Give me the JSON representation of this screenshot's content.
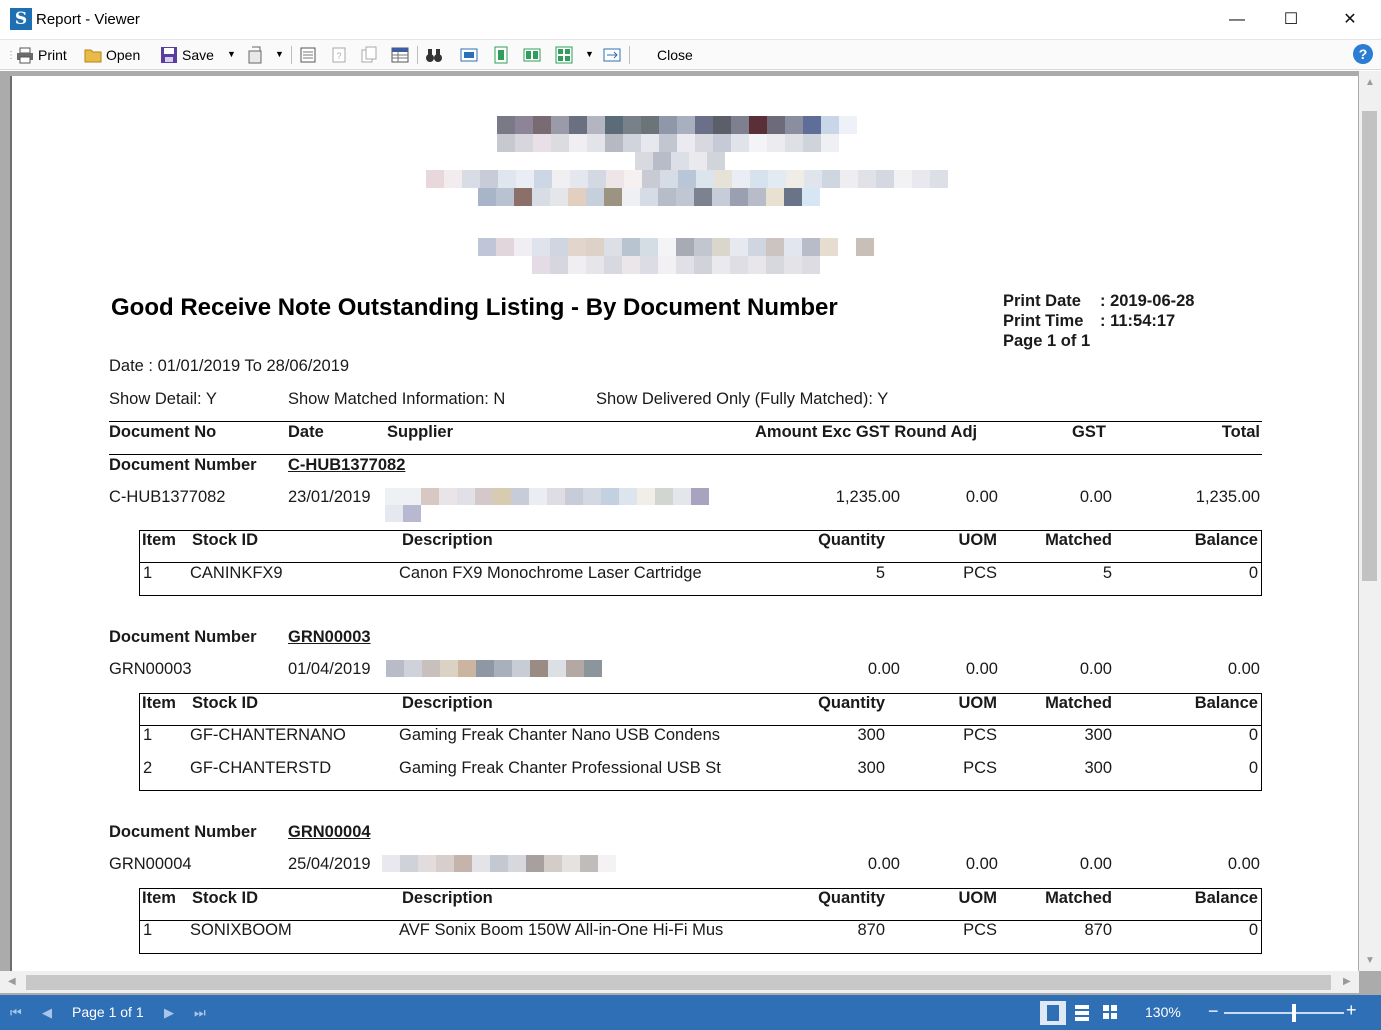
{
  "window": {
    "title": "Report - Viewer",
    "min": "—",
    "max": "☐",
    "close": "✕"
  },
  "toolbar": {
    "print": "Print",
    "open": "Open",
    "save": "Save",
    "close": "Close",
    "help": "?"
  },
  "report": {
    "title": "Good Receive Note Outstanding Listing - By Document Number",
    "print_date_label": "Print Date",
    "print_date_value": ": 2019-06-28",
    "print_time_label": "Print Time",
    "print_time_value": ": 11:54:17",
    "page_label": "Page 1 of 1",
    "date_range": "Date : 01/01/2019 To 28/06/2019",
    "show_detail": "Show Detail: Y",
    "show_matched": "Show Matched Information: N",
    "show_delivered": "Show Delivered Only (Fully Matched): Y",
    "headers": {
      "doc_no": "Document No",
      "date": "Date",
      "supplier": "Supplier",
      "amount": "Amount Exc GST Round Adj",
      "gst": "GST",
      "total": "Total"
    },
    "detail_headers": {
      "item": "Item",
      "stock_id": "Stock ID",
      "description": "Description",
      "quantity": "Quantity",
      "uom": "UOM",
      "matched": "Matched",
      "balance": "Balance"
    },
    "doc_number_label": "Document Number",
    "groups": [
      {
        "doc_number": "C-HUB1377082",
        "row": {
          "doc_no": "C-HUB1377082",
          "date": "23/01/2019",
          "amount": "1,235.00",
          "round_adj": "0.00",
          "gst": "0.00",
          "total": "1,235.00"
        },
        "items": [
          {
            "item": "1",
            "stock_id": "CANINKFX9",
            "description": "Canon FX9 Monochrome Laser Cartridge",
            "quantity": "5",
            "uom": "PCS",
            "matched": "5",
            "balance": "0"
          }
        ]
      },
      {
        "doc_number": "GRN00003",
        "row": {
          "doc_no": "GRN00003",
          "date": "01/04/2019",
          "amount": "0.00",
          "round_adj": "0.00",
          "gst": "0.00",
          "total": "0.00"
        },
        "items": [
          {
            "item": "1",
            "stock_id": "GF-CHANTERNANO",
            "description": "Gaming Freak Chanter Nano USB Condens",
            "quantity": "300",
            "uom": "PCS",
            "matched": "300",
            "balance": "0"
          },
          {
            "item": "2",
            "stock_id": "GF-CHANTERSTD",
            "description": "Gaming Freak Chanter Professional USB St",
            "quantity": "300",
            "uom": "PCS",
            "matched": "300",
            "balance": "0"
          }
        ]
      },
      {
        "doc_number": "GRN00004",
        "row": {
          "doc_no": "GRN00004",
          "date": "25/04/2019",
          "amount": "0.00",
          "round_adj": "0.00",
          "gst": "0.00",
          "total": "0.00"
        },
        "items": [
          {
            "item": "1",
            "stock_id": "SONIXBOOM",
            "description": "AVF Sonix Boom 150W All-in-One Hi-Fi Mus",
            "quantity": "870",
            "uom": "PCS",
            "matched": "870",
            "balance": "0"
          }
        ]
      }
    ]
  },
  "statusbar": {
    "page": "Page 1 of 1",
    "zoom": "130%",
    "zoom_level_percent": 130
  },
  "colors": {
    "accent": "#2f6fb6",
    "viewer_bg": "#ababab"
  }
}
